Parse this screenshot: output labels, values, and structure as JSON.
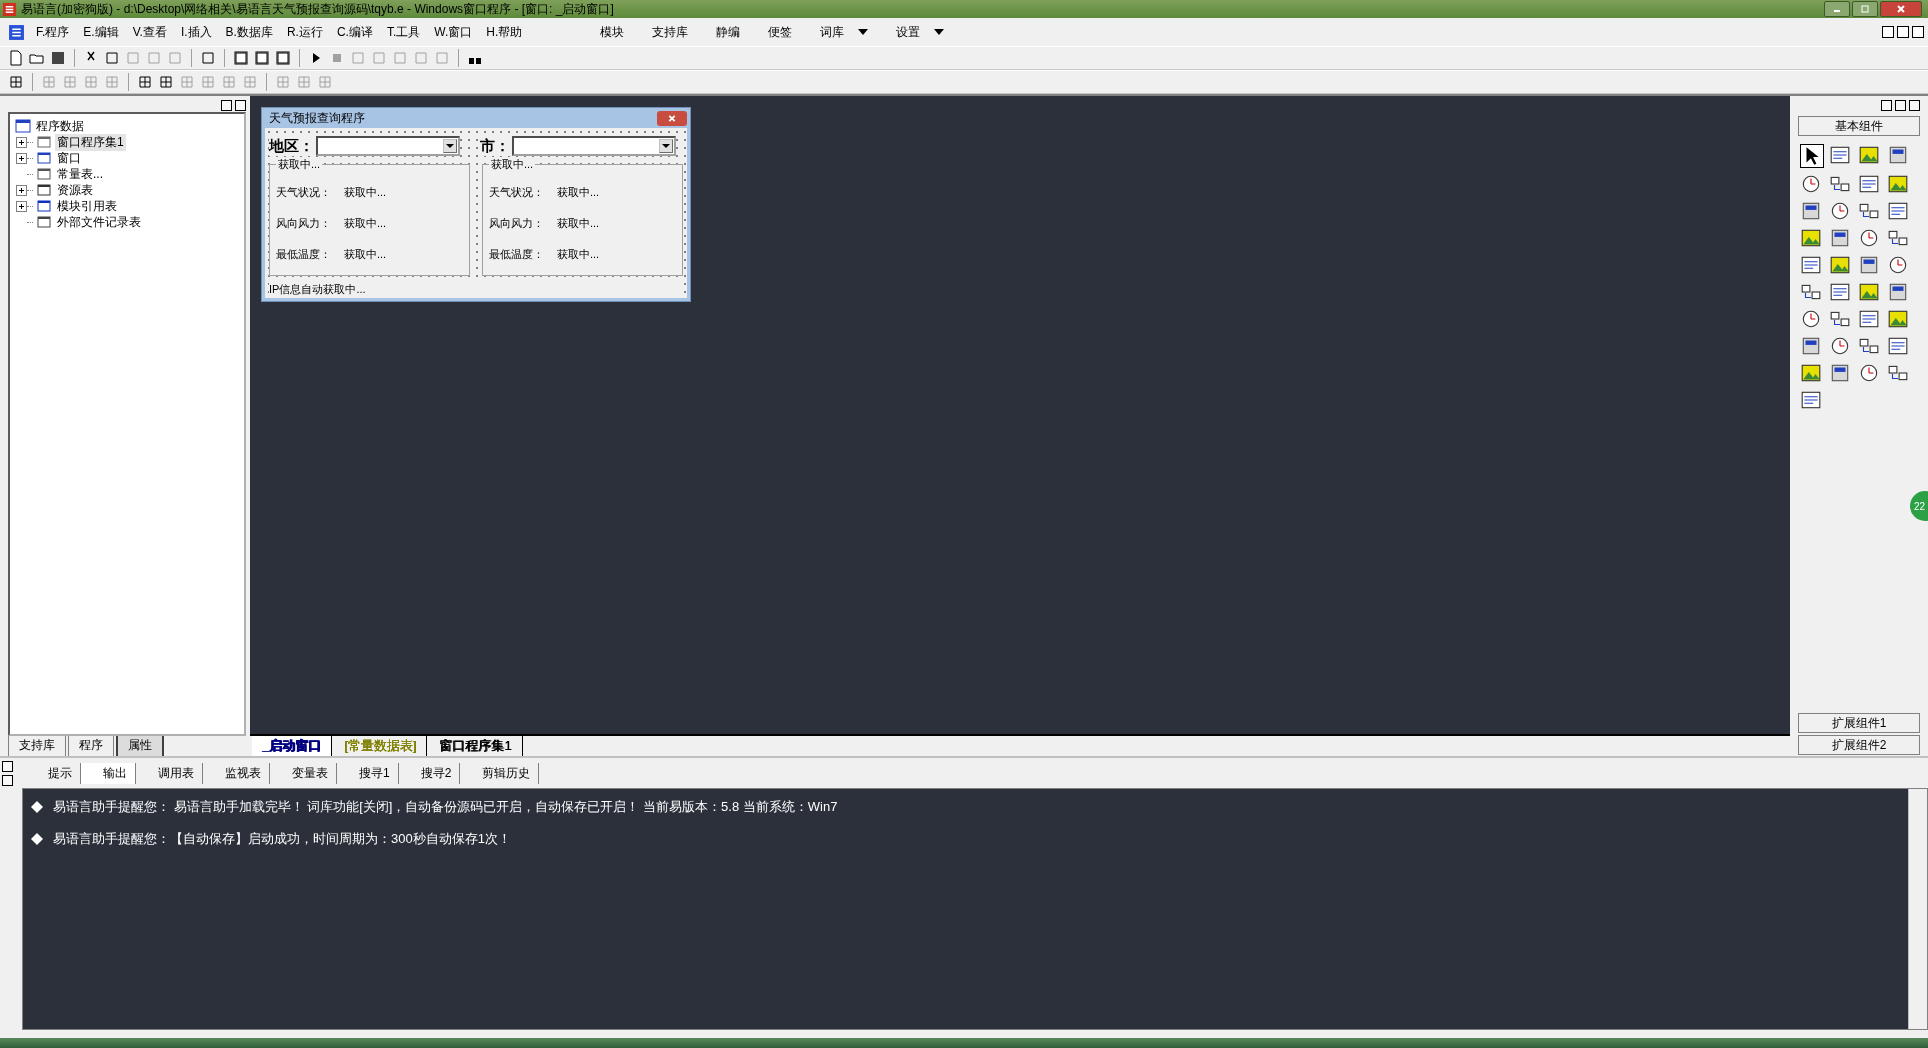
{
  "window": {
    "title": "易语言(加密狗版) - d:\\Desktop\\网络相关\\易语言天气预报查询源码\\tqyb.e - Windows窗口程序 - [窗口: _启动窗口]"
  },
  "menu": [
    {
      "label": "F.程序"
    },
    {
      "label": "E.编辑"
    },
    {
      "label": "V.查看"
    },
    {
      "label": "I.插入"
    },
    {
      "label": "B.数据库"
    },
    {
      "label": "R.运行"
    },
    {
      "label": "C.编译"
    },
    {
      "label": "T.工具"
    },
    {
      "label": "W.窗口"
    },
    {
      "label": "H.帮助"
    }
  ],
  "menu_right": [
    {
      "label": "模块",
      "dropdown": false
    },
    {
      "label": "支持库",
      "dropdown": false
    },
    {
      "label": "静编",
      "dropdown": false
    },
    {
      "label": "便签",
      "dropdown": false
    },
    {
      "label": "词库",
      "dropdown": true
    },
    {
      "label": "设置",
      "dropdown": true
    }
  ],
  "tree": {
    "root": "程序数据",
    "children": [
      {
        "label": "窗口程序集1",
        "kind": "modules",
        "expandable": true,
        "selected": true
      },
      {
        "label": "窗口",
        "kind": "window",
        "expandable": true,
        "selected": false
      },
      {
        "label": "常量表...",
        "kind": "constants",
        "expandable": false,
        "selected": false
      },
      {
        "label": "资源表",
        "kind": "resources",
        "expandable": true,
        "selected": false
      },
      {
        "label": "模块引用表",
        "kind": "import",
        "expandable": true,
        "selected": false
      },
      {
        "label": "外部文件记录表",
        "kind": "file",
        "expandable": false,
        "selected": false
      }
    ]
  },
  "left_tabs": [
    {
      "label": "支持库",
      "selected": false
    },
    {
      "label": "程序",
      "selected": false
    },
    {
      "label": "属性",
      "selected": true
    }
  ],
  "form": {
    "title": "天气预报查询程序",
    "region_label": "地区：",
    "city_label": "市：",
    "groups": [
      {
        "title": "获取中...",
        "rows": [
          {
            "label": "天气状况：",
            "value": "获取中..."
          },
          {
            "label": "风向风力：",
            "value": "获取中..."
          },
          {
            "label": "最低温度：",
            "value": "获取中..."
          }
        ]
      },
      {
        "title": "获取中...",
        "rows": [
          {
            "label": "天气状况：",
            "value": "获取中..."
          },
          {
            "label": "风向风力：",
            "value": "获取中..."
          },
          {
            "label": "最低温度：",
            "value": "获取中..."
          }
        ]
      }
    ],
    "status": "IP信息自动获取中..."
  },
  "doc_tabs": [
    {
      "label": "_启动窗口",
      "selected": true,
      "color": "#000080"
    },
    {
      "label": "[常量数据表]",
      "selected": false,
      "color": "#808000"
    },
    {
      "label": "窗口程序集1",
      "selected": false,
      "color": "#000000"
    }
  ],
  "palette": {
    "title": "基本组件",
    "extras": [
      "扩展组件1",
      "扩展组件2"
    ]
  },
  "output_tabs": [
    {
      "label": "提示",
      "selected": false
    },
    {
      "label": "输出",
      "selected": true
    },
    {
      "label": "调用表",
      "selected": false
    },
    {
      "label": "监视表",
      "selected": false
    },
    {
      "label": "变量表",
      "selected": false
    },
    {
      "label": "搜寻1",
      "selected": false
    },
    {
      "label": "搜寻2",
      "selected": false
    },
    {
      "label": "剪辑历史",
      "selected": false
    }
  ],
  "messages": [
    "易语言助手提醒您：  易语言助手加载完毕！ 词库功能[关闭]，自动备份源码已开启，自动保存已开启！ 当前易版本：5.8  当前系统：Win7",
    "易语言助手提醒您：【自动保存】启动成功，时间周期为：300秒自动保存1次！"
  ],
  "badge": "22"
}
